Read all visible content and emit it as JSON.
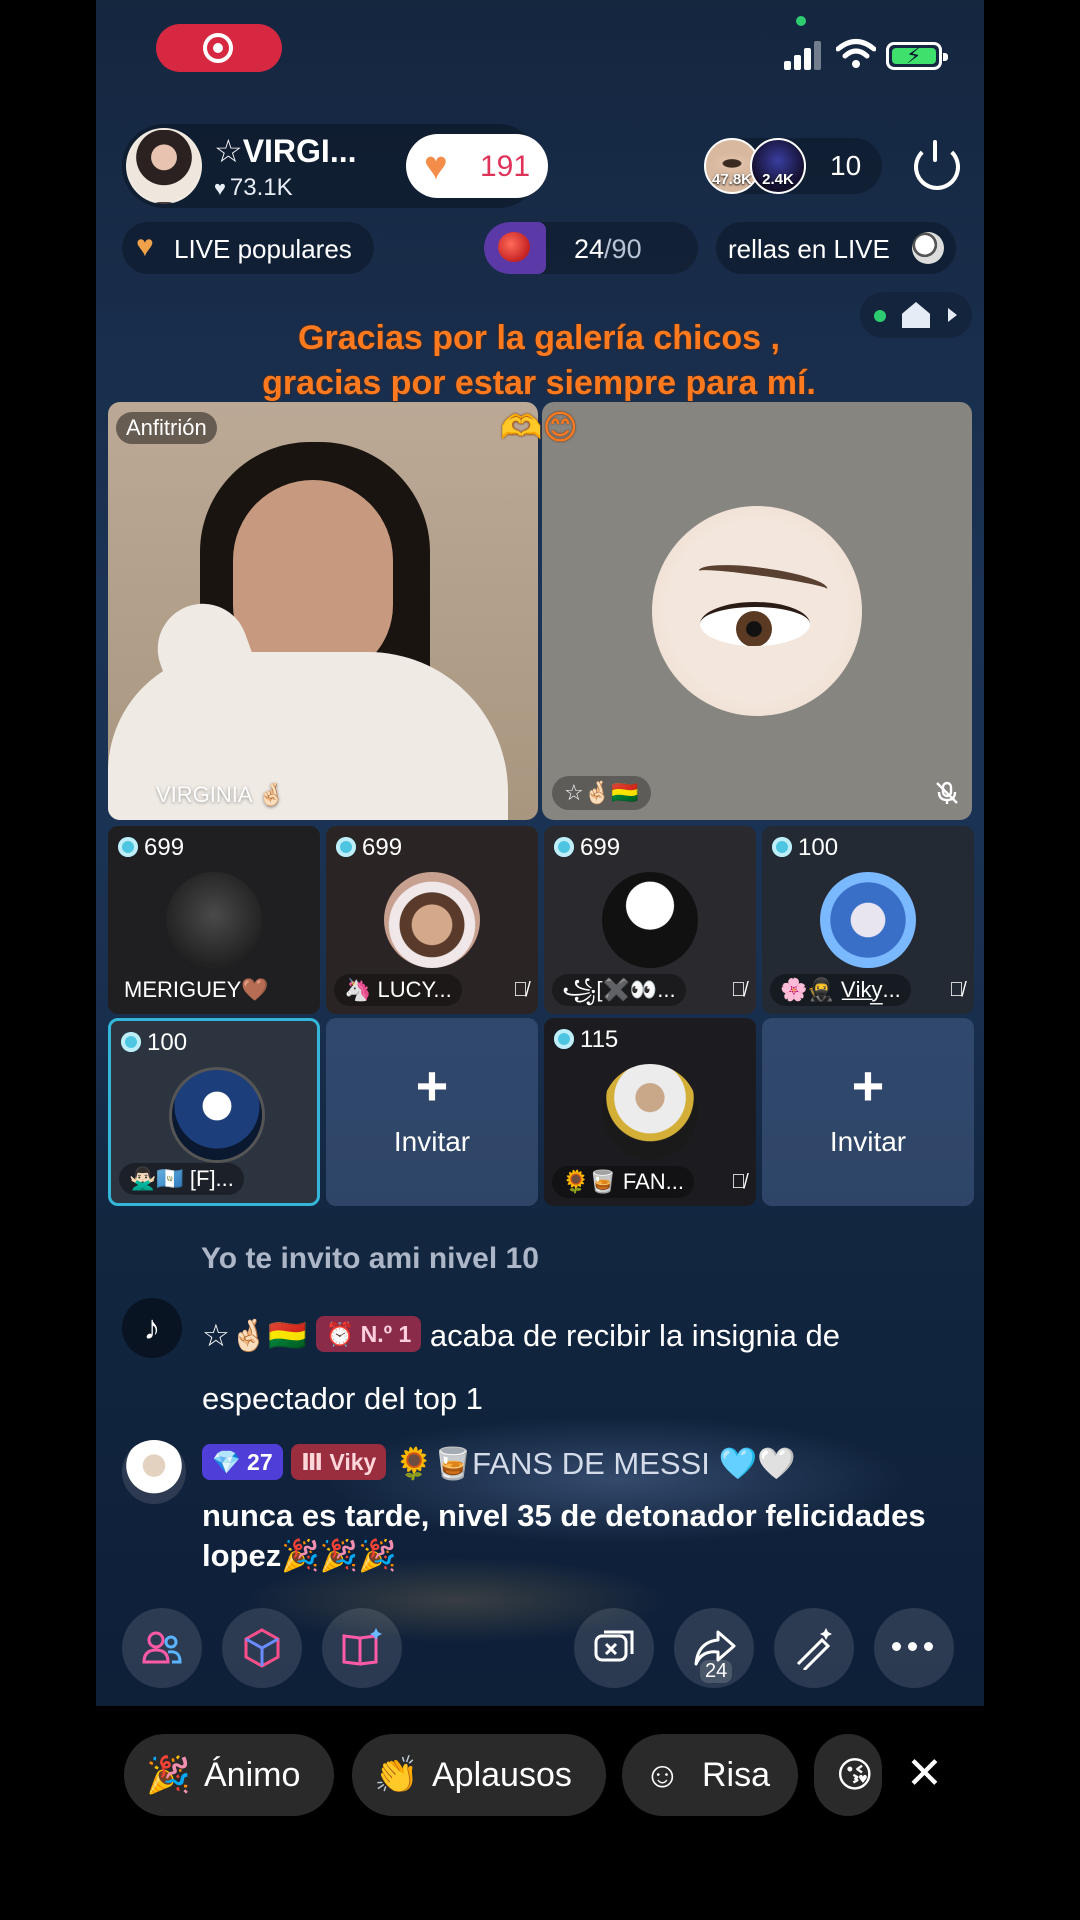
{
  "host": {
    "name": "☆VIRGI...",
    "likes": "73.1K",
    "gift_count": "191"
  },
  "viewers": {
    "avatar1_label": "47.8K",
    "avatar2_label": "2.4K",
    "count": "10"
  },
  "badges": {
    "popular_label": "LIVE populares",
    "tomato_current": "24",
    "tomato_total": "/90",
    "stars_label": "rellas en LIVE"
  },
  "overlay_message": "Gracias por la galería chicos , gracias por estar siempre para mí. 🫶😊",
  "host_video": {
    "tag": "Anfitrión",
    "label": "VIRGINIA 🤞🏻"
  },
  "guest_video": {
    "tag": "☆🤞🏻🇧🇴"
  },
  "guests": [
    {
      "score": "699",
      "name": "MERIGUEY🤎",
      "muted": false
    },
    {
      "score": "699",
      "name": "🦄 LUCY...",
      "muted": true
    },
    {
      "score": "699",
      "name": "꧁[✖️👀...",
      "muted": true
    },
    {
      "score": "100",
      "name": "🌸🥷 V̲i̲k̲y̲...",
      "muted": true
    },
    {
      "score": "100",
      "name": "🙅🏻‍♂️🇬🇹 [F]...",
      "muted": false
    },
    {
      "invite_label": "Invitar"
    },
    {
      "score": "115",
      "name": "🌻🥃 FAN...",
      "muted": true
    },
    {
      "invite_label": "Invitar"
    }
  ],
  "chat": {
    "faded": "Yo te invito ami nivel 10",
    "system_user": "☆🤞🏻🇧🇴",
    "system_badge": "N.º 1",
    "system_text": "acaba de recibir la insignia de espectador del top 1",
    "msg_level": "27",
    "msg_fan_badge": "Viky",
    "msg_user": "🌻🥃FANS DE MESSI 🩵🤍",
    "msg_text": "nunca es tarde, nivel 35 de detonador felicidades lopez🎉🎉🎉"
  },
  "toolbar": {
    "share_count": "24"
  },
  "reactions": {
    "items": [
      "Ánimo",
      "Aplausos",
      "Risa"
    ],
    "close": "✕"
  },
  "colors": {
    "accent_pink": "#e0335a",
    "overlay_orange": "#ff7a1e",
    "rec_red": "#d62840",
    "teal": "#33b6d8"
  }
}
